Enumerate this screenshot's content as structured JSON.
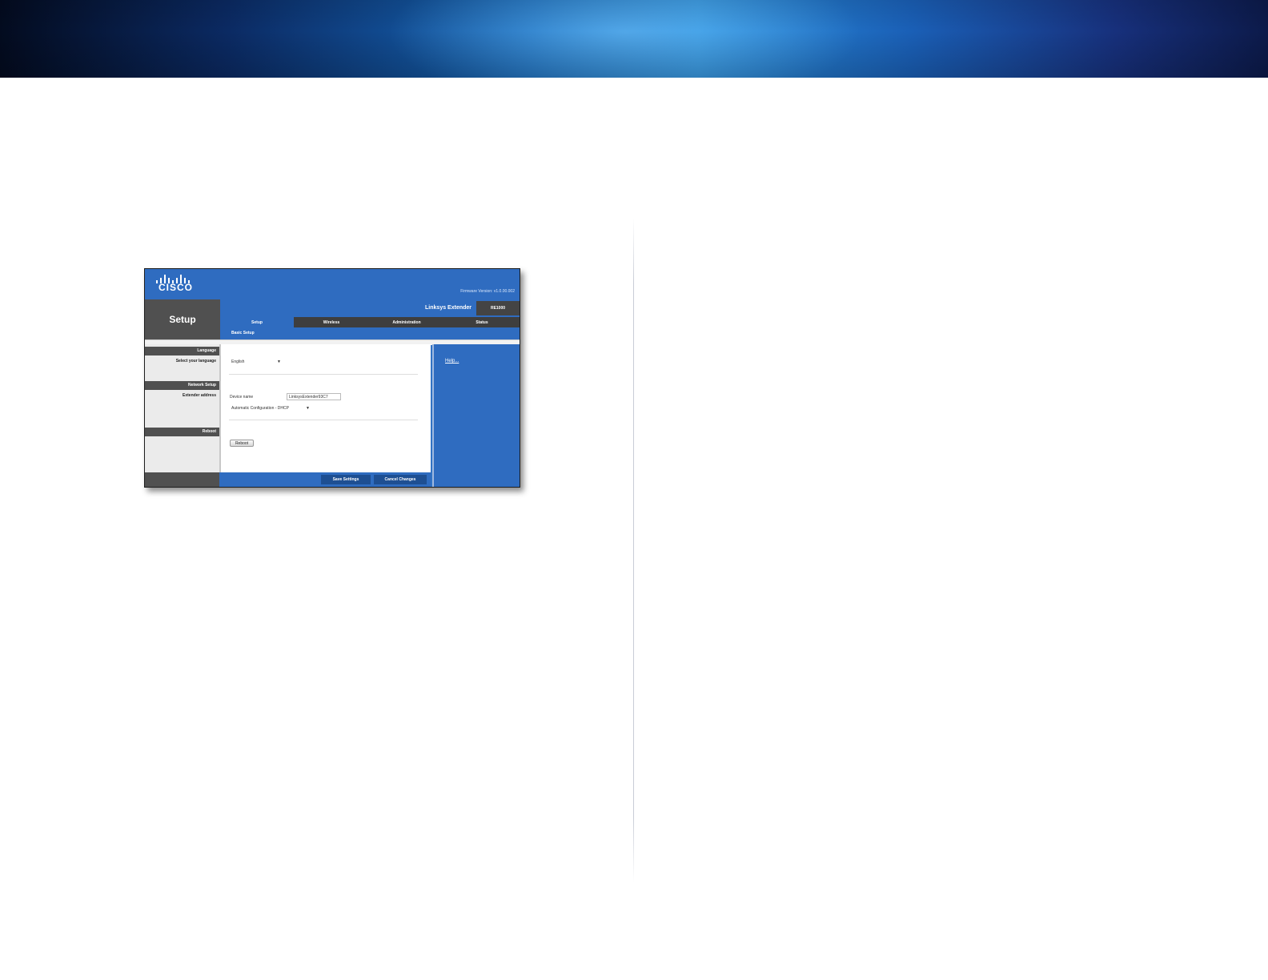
{
  "brand": {
    "logo_text": "CISCO",
    "firmware": "Firmware Version: v1.0.00.002"
  },
  "app": {
    "section_title": "Setup",
    "product_name": "Linksys Extender",
    "model": "RE1000"
  },
  "tabs": [
    {
      "label": "Setup",
      "active": true
    },
    {
      "label": "Wireless",
      "active": false
    },
    {
      "label": "Administration",
      "active": false
    },
    {
      "label": "Status",
      "active": false
    }
  ],
  "subtab": "Basic Setup",
  "sidebar": {
    "language_header": "Language",
    "language_label": "Select your language",
    "network_header": "Network Setup",
    "network_label": "Extender address",
    "reboot_header": "Reboot"
  },
  "form": {
    "language_value": "English",
    "device_name_label": "Device name",
    "device_name_value": "LinksysExtender93C7",
    "address_mode_value": "Automatic Configuration - DHCP",
    "reboot_button": "Reboot"
  },
  "help": {
    "link_label": "Help..."
  },
  "footer": {
    "save_button": "Save Settings",
    "cancel_button": "Cancel Changes"
  },
  "colors": {
    "accent_blue": "#2f6cc0",
    "dark_gray": "#505050"
  }
}
